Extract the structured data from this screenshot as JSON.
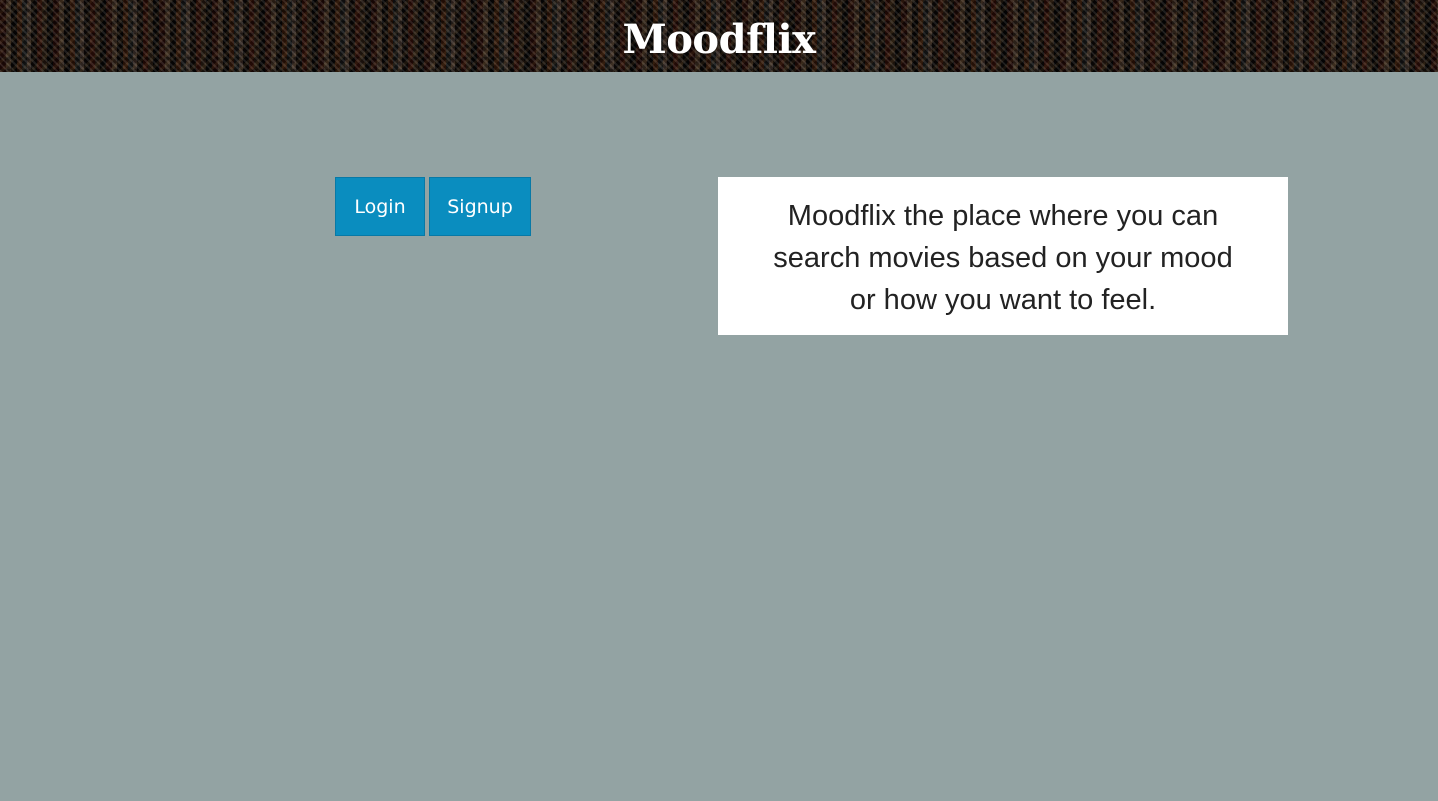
{
  "header": {
    "title": "Moodflix"
  },
  "auth": {
    "login_label": "Login",
    "signup_label": "Signup"
  },
  "intro": {
    "text": "Moodflix the place where you can search movies based on your mood or how you want to feel."
  },
  "colors": {
    "background": "#93a3a3",
    "button": "#0a8dbf",
    "info_box": "#ffffff"
  }
}
